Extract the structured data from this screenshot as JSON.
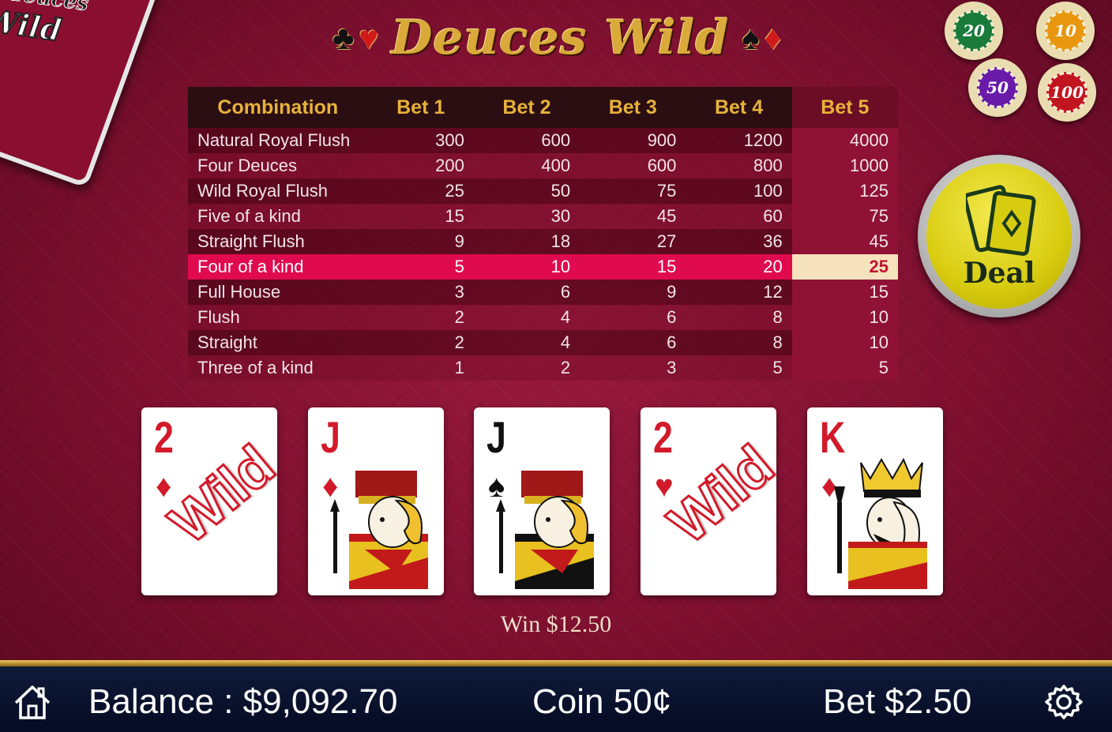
{
  "title": "Deuces Wild",
  "title_suits_left": [
    "♣",
    "♥"
  ],
  "title_suits_right": [
    "♠",
    "♦"
  ],
  "deck_logo": {
    "top": "deuces",
    "bottom": "Wild"
  },
  "paytable": {
    "headers": [
      "Combination",
      "Bet 1",
      "Bet 2",
      "Bet 3",
      "Bet 4",
      "Bet 5"
    ],
    "rows": [
      {
        "name": "Natural Royal Flush",
        "values": [
          "300",
          "600",
          "900",
          "1200",
          "4000"
        ]
      },
      {
        "name": "Four Deuces",
        "values": [
          "200",
          "400",
          "600",
          "800",
          "1000"
        ]
      },
      {
        "name": "Wild Royal Flush",
        "values": [
          "25",
          "50",
          "75",
          "100",
          "125"
        ]
      },
      {
        "name": "Five of a kind",
        "values": [
          "15",
          "30",
          "45",
          "60",
          "75"
        ]
      },
      {
        "name": "Straight Flush",
        "values": [
          "9",
          "18",
          "27",
          "36",
          "45"
        ]
      },
      {
        "name": "Four of a kind",
        "values": [
          "5",
          "10",
          "15",
          "20",
          "25"
        ]
      },
      {
        "name": "Full House",
        "values": [
          "3",
          "6",
          "9",
          "12",
          "15"
        ]
      },
      {
        "name": "Flush",
        "values": [
          "2",
          "4",
          "6",
          "8",
          "10"
        ]
      },
      {
        "name": "Straight",
        "values": [
          "2",
          "4",
          "6",
          "8",
          "10"
        ]
      },
      {
        "name": "Three of a kind",
        "values": [
          "1",
          "2",
          "3",
          "5",
          "5"
        ]
      }
    ],
    "highlighted_row": "Four of a kind",
    "selected_bet": "Bet 5"
  },
  "chips": [
    {
      "label": "20",
      "color": "#1a7a3a"
    },
    {
      "label": "10",
      "color": "#e8960e"
    },
    {
      "label": "50",
      "color": "#6a1aa8"
    },
    {
      "label": "100",
      "color": "#c21520"
    }
  ],
  "deal_label": "Deal",
  "cards": [
    {
      "rank": "2",
      "suit": "♦",
      "color": "#d21a2a",
      "wild_label": "Wild",
      "face": "wild"
    },
    {
      "rank": "J",
      "suit": "♦",
      "color": "#d21a2a",
      "face": "jack"
    },
    {
      "rank": "J",
      "suit": "♠",
      "color": "#111111",
      "face": "jack"
    },
    {
      "rank": "2",
      "suit": "♥",
      "color": "#d21a2a",
      "wild_label": "Wild",
      "face": "wild"
    },
    {
      "rank": "K",
      "suit": "♦",
      "color": "#d21a2a",
      "face": "king"
    }
  ],
  "win_text": "Win $12.50",
  "status": {
    "balance": "Balance : $9,092.70",
    "coin": "Coin 50¢",
    "bet": "Bet $2.50"
  }
}
